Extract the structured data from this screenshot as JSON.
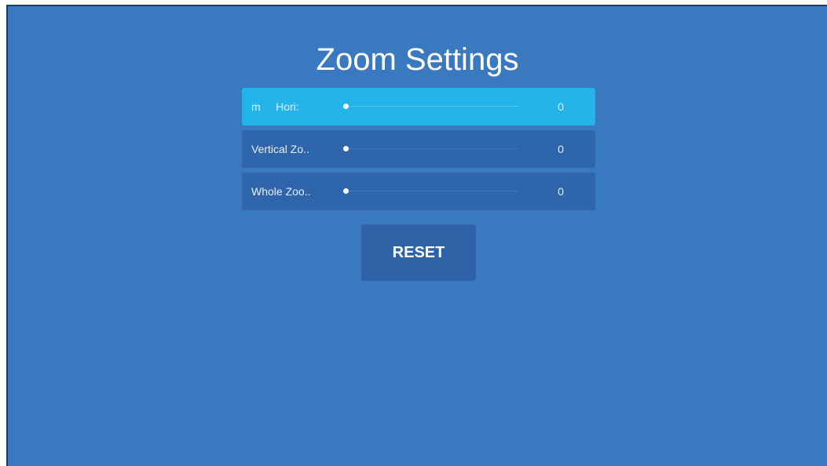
{
  "title": "Zoom Settings",
  "rows": [
    {
      "label": "m     Hori:",
      "value": "0",
      "level": 0,
      "focused": true
    },
    {
      "label": "Vertical Zo..",
      "value": "0",
      "level": 0,
      "focused": false
    },
    {
      "label": "Whole Zoo..",
      "value": "0",
      "level": 0,
      "focused": false
    }
  ],
  "reset_label": "RESET",
  "colors": {
    "background": "#3a79c0",
    "row": "#2f65aa",
    "row_focused": "#25b4ea",
    "button": "#2d62a7",
    "text": "#ffffff"
  }
}
